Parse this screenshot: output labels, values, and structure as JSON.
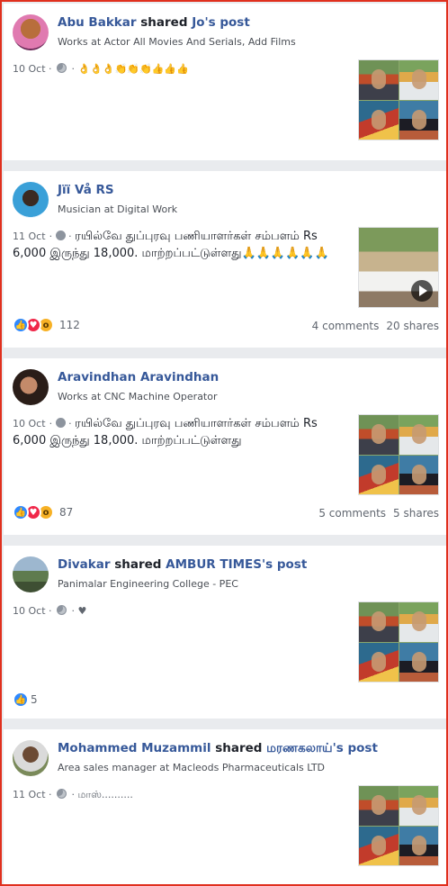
{
  "posts": [
    {
      "author": "Abu Bakkar",
      "action": "shared",
      "target": "Jo's post",
      "subtitle": "Works at Actor All Movies And Serials, Add Films",
      "date": "10 Oct",
      "text": "👌👌👌👏👏👏👍👍👍",
      "media": "collage",
      "reaction_count": "",
      "comments": "",
      "shares": ""
    },
    {
      "author": "Jïï Vå RS",
      "action": "",
      "target": "",
      "subtitle": "Musician at Digital Work",
      "date": "11 Oct",
      "text": "ரயில்வே துப்புரவு பணியாளர்கள் சம்பளம் Rs 6,000 இருந்து 18,000. மாற்றப்பட்டுள்ளது🙏🙏🙏🙏🙏🙏",
      "media": "video",
      "reaction_count": "112",
      "comments": "4 comments",
      "shares": "20 shares"
    },
    {
      "author": "Aravindhan Aravindhan",
      "action": "",
      "target": "",
      "subtitle": "Works at CNC Machine Operator",
      "date": "10 Oct",
      "text": "ரயில்வே துப்புரவு பணியாளர்கள் சம்பளம் Rs 6,000 இருந்து 18,000. மாற்றப்பட்டுள்ளது",
      "media": "collage",
      "reaction_count": "87",
      "comments": "5 comments",
      "shares": "5 shares"
    },
    {
      "author": "Divakar",
      "action": "shared",
      "target": "AMBUR TIMES's post",
      "subtitle": "Panimalar Engineering College - PEC",
      "date": "10 Oct",
      "text": "♥",
      "media": "collage",
      "reaction_count": "5",
      "comments": "",
      "shares": ""
    },
    {
      "author": "Mohammed Muzammil",
      "action": "shared",
      "target": "மரணகலாய்'s post",
      "subtitle": "Area sales manager at Macleods Pharmaceuticals LTD",
      "date": "11 Oct",
      "text": "மாஸ்..........",
      "media": "collage",
      "reaction_count": "",
      "comments": "",
      "shares": ""
    }
  ],
  "icons": {
    "globe": "globe-icon",
    "like": "like-reaction-icon",
    "love": "love-reaction-icon",
    "wow": "wow-reaction-icon",
    "play": "play-icon"
  },
  "colors": {
    "link": "#365899",
    "muted": "#616770",
    "like": "#2e89ff",
    "love": "#f0284a",
    "wow": "#f7b125",
    "frame_border": "#e0301e"
  }
}
